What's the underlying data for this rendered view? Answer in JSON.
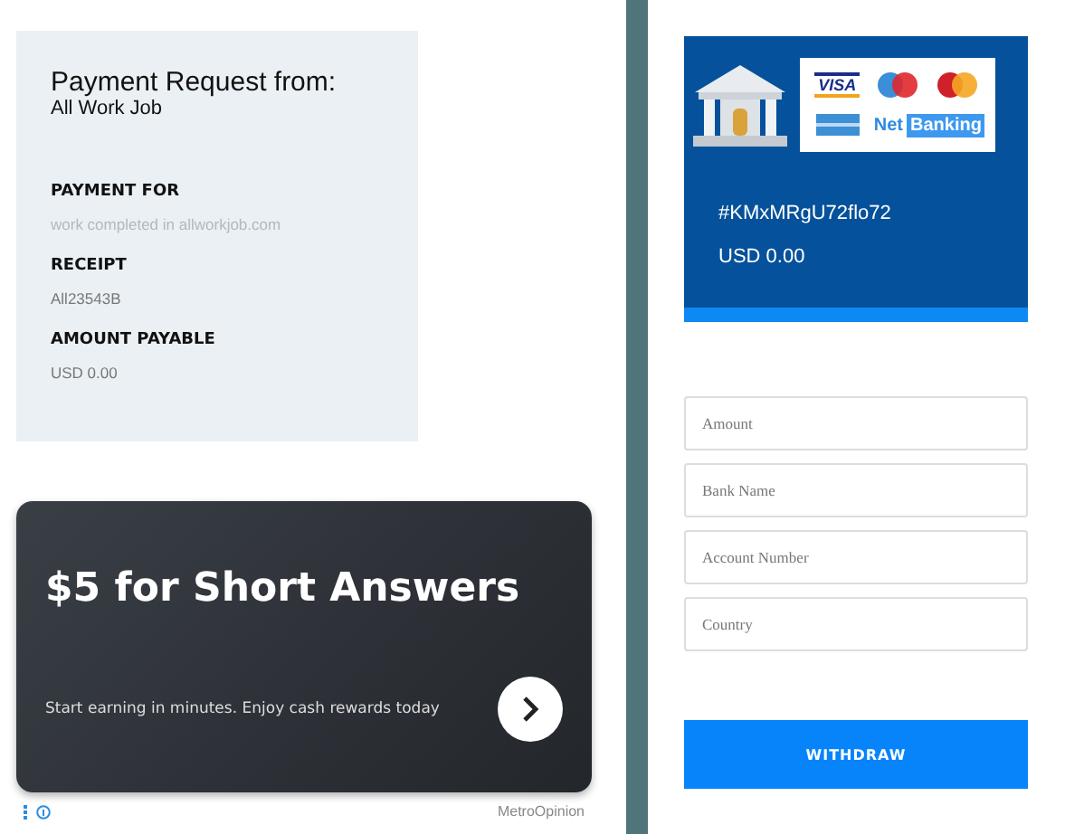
{
  "request": {
    "title": "Payment Request from:",
    "sender": "All Work Job",
    "sections": [
      {
        "label": "PAYMENT FOR",
        "value": "work completed in allworkjob.com",
        "muted": true
      },
      {
        "label": "RECEIPT",
        "value": "All23543B",
        "muted": false
      },
      {
        "label": "AMOUNT PAYABLE",
        "value": "USD 0.00",
        "muted": false
      }
    ]
  },
  "ad": {
    "headline": "$5 for Short Answers",
    "text": "Start earning in minutes. Enjoy cash rewards today",
    "advertiser": "MetroOpinion"
  },
  "payment": {
    "logos": {
      "card": "VISA",
      "net": "Net",
      "banking": "Banking"
    },
    "reference": "#KMxMRgU72flo72",
    "amount": "USD 0.00"
  },
  "form": {
    "fields": [
      {
        "placeholder": "Amount"
      },
      {
        "placeholder": "Bank Name"
      },
      {
        "placeholder": "Account Number"
      },
      {
        "placeholder": "Country"
      }
    ],
    "button": "WITHDRAW"
  }
}
